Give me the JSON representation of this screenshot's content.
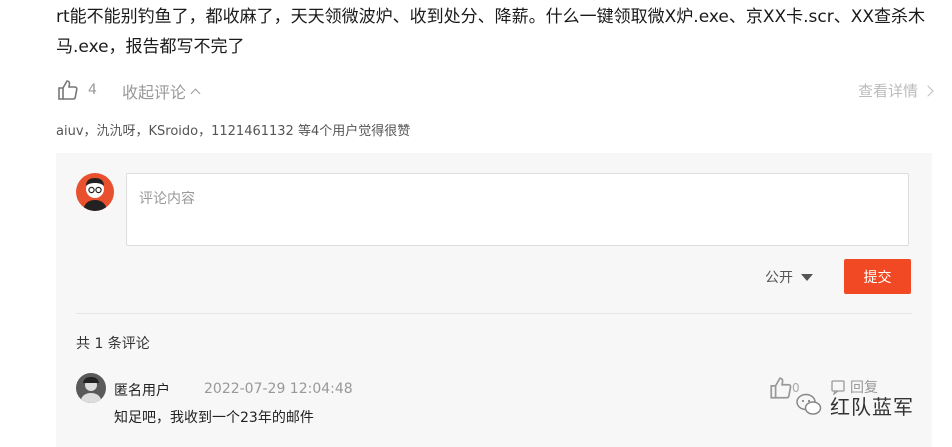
{
  "post": {
    "text": "rt能不能别钓鱼了，都收麻了，天天领微波炉、收到处分、降薪。什么一键领取微X炉.exe、京XX卡.scr、XX查杀木马.exe，报告都写不完了"
  },
  "actions": {
    "like_count": "4",
    "collapse_label": "收起评论",
    "detail_label": "查看详情"
  },
  "likers_text": "aiuv，氿氿呀，KSroido，1121461132 等4个用户觉得很赞",
  "composer": {
    "placeholder": "评论内容",
    "visibility": "公开",
    "submit_label": "提交"
  },
  "comments": {
    "count_label": "共 1 条评论",
    "items": [
      {
        "author": "匿名用户",
        "time": "2022-07-29 12:04:48",
        "text": "知足吧，我收到一个23年的邮件",
        "like_count": "0",
        "reply_label": "回复"
      }
    ]
  },
  "watermark": {
    "text": "红队蓝军"
  },
  "colors": {
    "accent": "#f04923",
    "panel_bg": "#f7f7f7",
    "muted": "#999999"
  }
}
